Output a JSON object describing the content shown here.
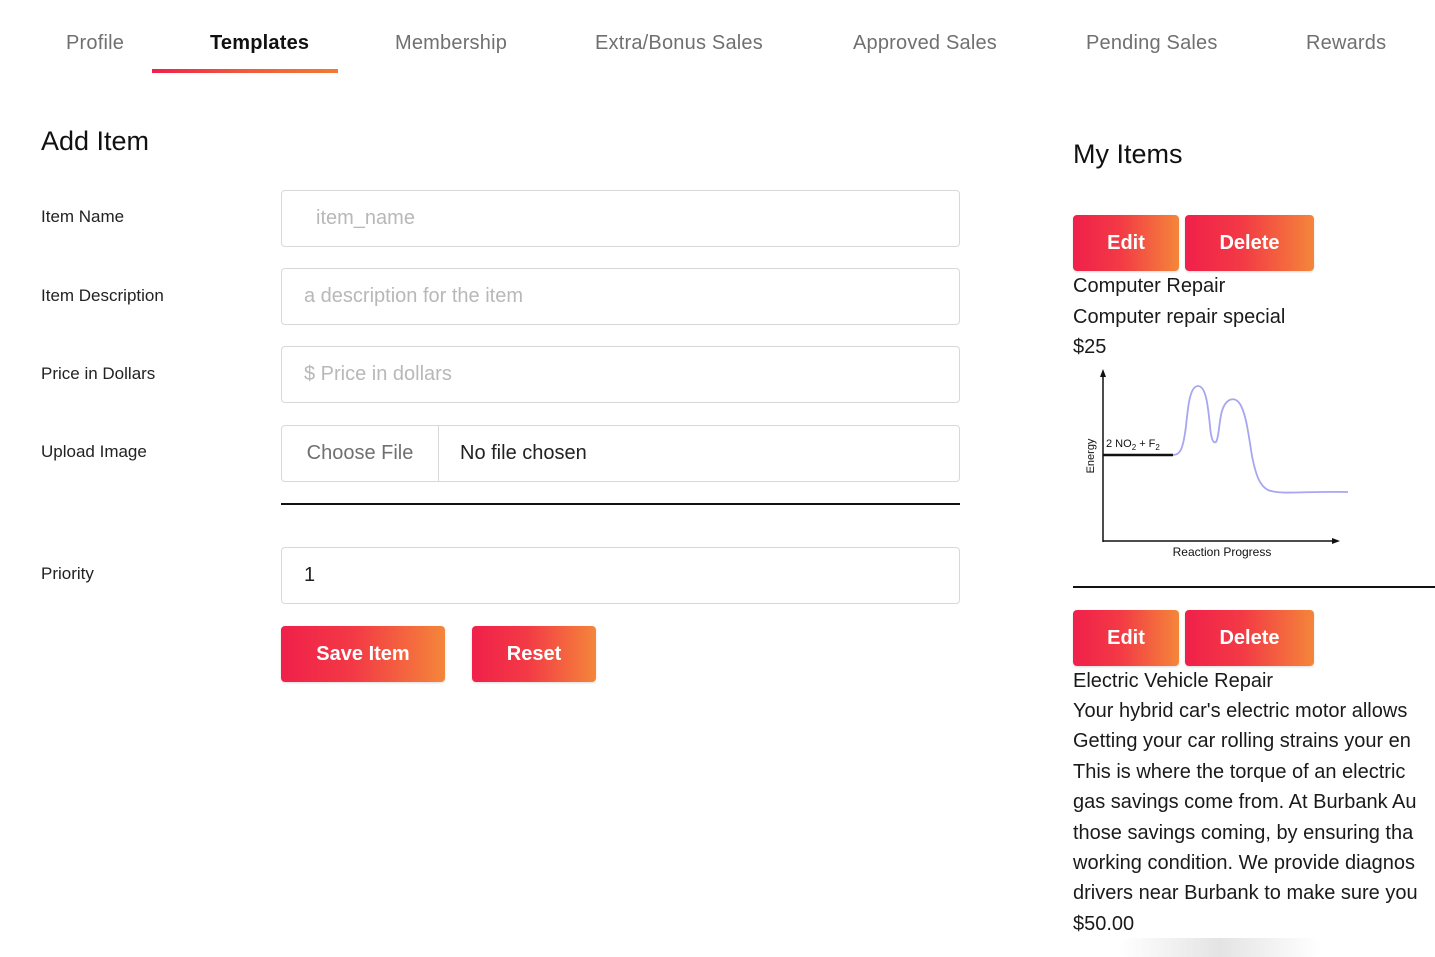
{
  "tabs": [
    {
      "label": "Profile"
    },
    {
      "label": "Templates"
    },
    {
      "label": "Membership"
    },
    {
      "label": "Extra/Bonus Sales"
    },
    {
      "label": "Approved Sales"
    },
    {
      "label": "Pending Sales"
    },
    {
      "label": "Rewards"
    }
  ],
  "active_tab": "Templates",
  "form": {
    "title": "Add Item",
    "item_name": {
      "label": "Item Name",
      "placeholder": "item_name",
      "value": ""
    },
    "item_description": {
      "label": "Item Description",
      "placeholder": "a description for the item",
      "value": ""
    },
    "price": {
      "label": "Price in Dollars",
      "placeholder": "$ Price in dollars",
      "value": ""
    },
    "upload": {
      "label": "Upload Image",
      "button_label": "Choose File",
      "status": "No file chosen"
    },
    "priority": {
      "label": "Priority",
      "value": "1"
    },
    "save_label": "Save Item",
    "reset_label": "Reset"
  },
  "my_items": {
    "title": "My Items",
    "edit_label": "Edit",
    "delete_label": "Delete",
    "items": [
      {
        "name": "Computer Repair",
        "description": "Computer repair special",
        "price": "$25",
        "image": {
          "y_axis_label": "Energy",
          "x_axis_label": "Reaction Progress",
          "reactant_label_main": "2 NO",
          "reactant_sub_1": "2",
          "reactant_label_plus": " + F",
          "reactant_sub_2": "2"
        }
      },
      {
        "name": "Electric Vehicle Repair",
        "description_lines": [
          "Your hybrid car's electric motor allows",
          "Getting your car rolling strains your en",
          "This is where the torque of an electric",
          "gas savings come from. At Burbank Au",
          "those savings coming, by ensuring tha",
          "working condition. We provide diagnos",
          "drivers near Burbank to make sure you"
        ],
        "price": "$50.00"
      }
    ]
  },
  "colors": {
    "accent_start": "#f0204a",
    "accent_end": "#f4863a",
    "curve": "#a7a6f2"
  }
}
